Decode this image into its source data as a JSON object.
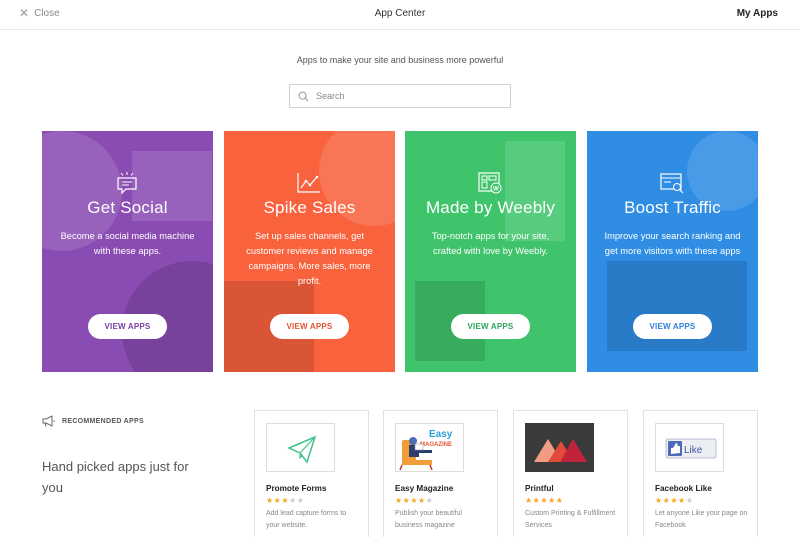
{
  "header": {
    "close_label": "Close",
    "title": "App Center",
    "my_apps_label": "My Apps"
  },
  "tagline": "Apps to make your site and business more powerful",
  "search": {
    "placeholder": "Search",
    "icon": "search-icon"
  },
  "categories": [
    {
      "title": "Get Social",
      "description": "Become a social media machine with these apps.",
      "button": "VIEW APPS",
      "color": "#8a4bb2",
      "icon": "chat-bubble-icon"
    },
    {
      "title": "Spike Sales",
      "description": "Set up sales channels, get customer reviews and manage campaigns. More sales, more profit.",
      "button": "VIEW APPS",
      "color": "#f8623d",
      "icon": "sales-chart-icon"
    },
    {
      "title": "Made by Weebly",
      "description": "Top-notch apps for your site, crafted with love by Weebly.",
      "button": "VIEW APPS",
      "color": "#3fc46c",
      "icon": "weebly-apps-icon"
    },
    {
      "title": "Boost Traffic",
      "description": "Improve your search ranking and get more visitors with these apps",
      "button": "VIEW APPS",
      "color": "#2f8de4",
      "icon": "browser-search-icon"
    }
  ],
  "recommended": {
    "label": "RECOMMENDED APPS",
    "headline": "Hand picked apps just for you",
    "icon": "megaphone-icon",
    "apps": [
      {
        "name": "Promote Forms",
        "rating": 3.5,
        "description": "Add lead capture forms to your website.",
        "icon": "paper-plane-icon"
      },
      {
        "name": "Easy Magazine",
        "rating": 4.5,
        "description": "Publish your beautiful business magazine",
        "logo_text_1": "Easy",
        "logo_text_2": "MAGAZINE",
        "icon": "reader-chair-icon"
      },
      {
        "name": "Printful",
        "rating": 5,
        "description": "Custom Printing & Fulfillment Services",
        "icon": "printful-mountains-icon"
      },
      {
        "name": "Facebook Like",
        "rating": 4,
        "description": "Let anyone Like your page on Facebook",
        "logo_text": "Like",
        "icon": "thumbs-up-icon"
      }
    ]
  }
}
